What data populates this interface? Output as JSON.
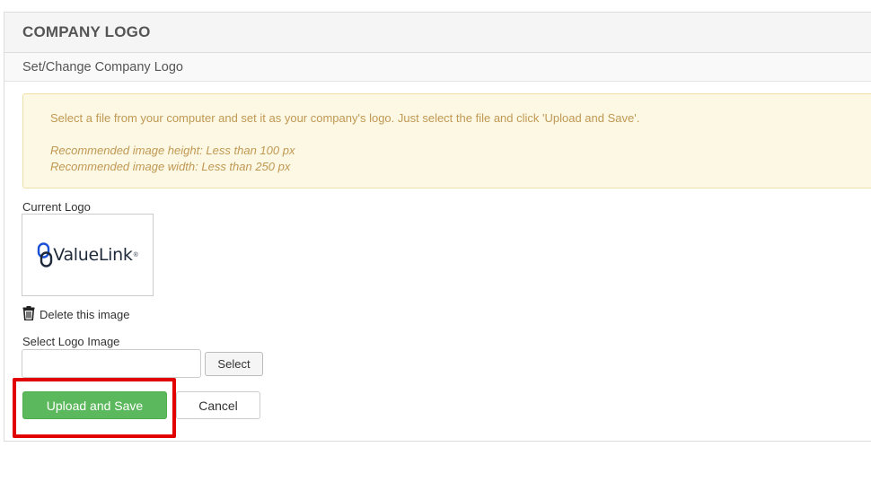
{
  "header": {
    "title": "COMPANY LOGO",
    "subtitle": "Set/Change Company Logo"
  },
  "alert": {
    "message": "Select a file from your computer and set it as your company's logo. Just select the file and click 'Upload and Save'.",
    "height_note": "Recommended image height: Less than 100 px",
    "width_note": "Recommended image width: Less than 250 px"
  },
  "current_logo": {
    "label": "Current Logo",
    "logo_text": "ValueLink",
    "logo_mark": "®"
  },
  "delete": {
    "label": "Delete this image",
    "icon": "trash-icon"
  },
  "file_select": {
    "label": "Select Logo Image",
    "value": "",
    "button": "Select"
  },
  "actions": {
    "upload_label": "Upload and Save",
    "cancel_label": "Cancel"
  },
  "colors": {
    "upload_green": "#5cb85c",
    "alert_bg": "#fcf8e3",
    "alert_text": "#c09853",
    "highlight_red": "#e00000",
    "logo_blue": "#1a4fd6"
  }
}
